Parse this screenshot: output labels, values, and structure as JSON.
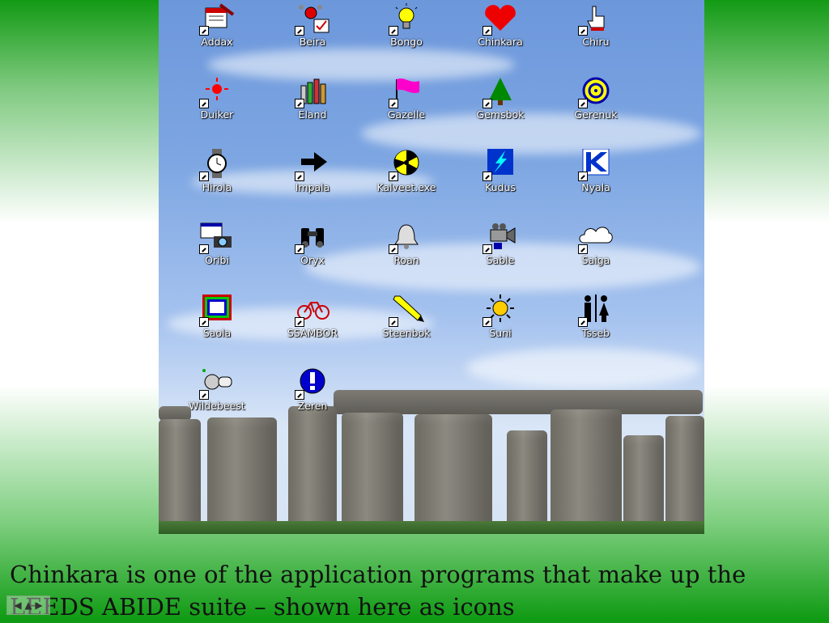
{
  "desktop": {
    "icons": [
      {
        "label": "Addax",
        "icon": "notepad-pencil-icon"
      },
      {
        "label": "Beira",
        "icon": "molecule-check-icon"
      },
      {
        "label": "Bongo",
        "icon": "lightbulb-icon"
      },
      {
        "label": "Chinkara",
        "icon": "heart-icon"
      },
      {
        "label": "Chiru",
        "icon": "hand-pointer-icon"
      },
      {
        "label": "Duiker",
        "icon": "red-star-burst-icon"
      },
      {
        "label": "Eland",
        "icon": "pencils-icon"
      },
      {
        "label": "Gazelle",
        "icon": "pink-flag-icon"
      },
      {
        "label": "Gemsbok",
        "icon": "tree-icon"
      },
      {
        "label": "Gerenuk",
        "icon": "target-icon"
      },
      {
        "label": "Hirola",
        "icon": "watch-icon"
      },
      {
        "label": "Impala",
        "icon": "arrow-right-icon"
      },
      {
        "label": "Kalveet.exe",
        "icon": "radiation-icon"
      },
      {
        "label": "Kudus",
        "icon": "lightning-icon"
      },
      {
        "label": "Nyala",
        "icon": "k-logo-icon"
      },
      {
        "label": "Oribi",
        "icon": "camera-icon"
      },
      {
        "label": "Oryx",
        "icon": "binoculars-icon"
      },
      {
        "label": "Roan",
        "icon": "bell-icon"
      },
      {
        "label": "Sable",
        "icon": "video-camera-icon"
      },
      {
        "label": "Saiga",
        "icon": "cloud-icon"
      },
      {
        "label": "Saola",
        "icon": "frame-icon"
      },
      {
        "label": "SSAMBOR",
        "icon": "bicycle-icon"
      },
      {
        "label": "Steenbok",
        "icon": "pencil-icon"
      },
      {
        "label": "Suni",
        "icon": "sun-icon"
      },
      {
        "label": "Tsseb",
        "icon": "people-icon"
      },
      {
        "label": "Wildebeest",
        "icon": "key-icon"
      },
      {
        "label": "Zeren",
        "icon": "exclamation-icon"
      }
    ]
  },
  "caption": {
    "line1": "Chinkara is one of the application programs that make up the",
    "line2": "LEEDS ABIDE suite – shown here as icons"
  },
  "colors": {
    "background_green": "#129a14",
    "sky": "#7da6e2"
  }
}
